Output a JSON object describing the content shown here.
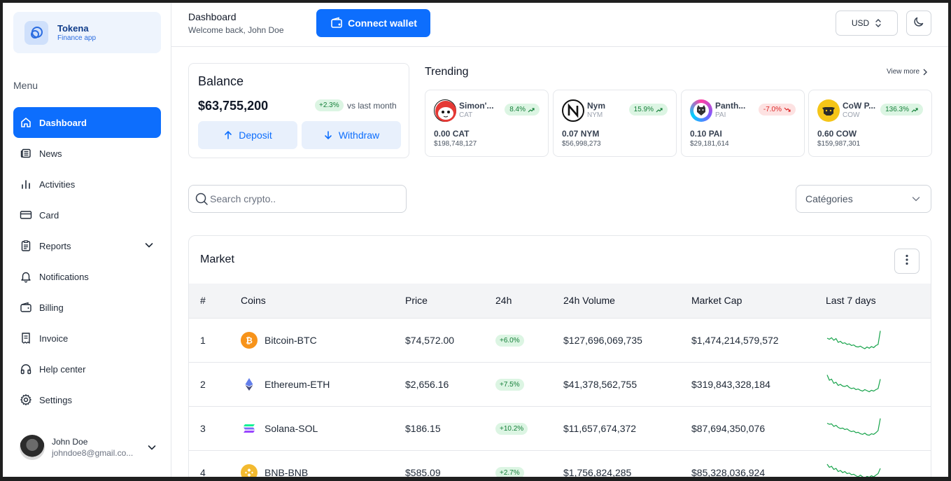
{
  "brand": {
    "name": "Tokena",
    "subtitle": "Finance app"
  },
  "menu": {
    "title": "Menu",
    "items": [
      {
        "label": "Dashboard",
        "icon": "home-icon",
        "active": true
      },
      {
        "label": "News",
        "icon": "newspaper-icon"
      },
      {
        "label": "Activities",
        "icon": "bar-chart-icon"
      },
      {
        "label": "Card",
        "icon": "credit-card-icon"
      },
      {
        "label": "Reports",
        "icon": "clipboard-icon",
        "expandable": true
      },
      {
        "label": "Notifications",
        "icon": "bell-icon"
      },
      {
        "label": "Billing",
        "icon": "wallet-icon"
      },
      {
        "label": "Invoice",
        "icon": "receipt-icon"
      },
      {
        "label": "Help center",
        "icon": "headphones-icon"
      },
      {
        "label": "Settings",
        "icon": "gear-icon"
      }
    ]
  },
  "user": {
    "name": "John Doe",
    "email": "johndoe8@gmail.co..."
  },
  "header": {
    "title": "Dashboard",
    "subtitle": "Welcome back, John Doe",
    "connect_label": "Connect wallet",
    "currency": "USD"
  },
  "balance": {
    "title": "Balance",
    "amount": "$63,755,200",
    "change": "+2.3%",
    "compare": "vs last month",
    "deposit_label": "Deposit",
    "withdraw_label": "Withdraw"
  },
  "trending": {
    "title": "Trending",
    "view_more": "View more",
    "items": [
      {
        "name": "Simon'...",
        "symbol": "CAT",
        "change": "8.4%",
        "direction": "up",
        "holding": "0.00 CAT",
        "value": "$198,748,127"
      },
      {
        "name": "Nym",
        "symbol": "NYM",
        "change": "15.9%",
        "direction": "up",
        "holding": "0.07 NYM",
        "value": "$56,998,273"
      },
      {
        "name": "Panth...",
        "symbol": "PAI",
        "change": "-7.0%",
        "direction": "down",
        "holding": "0.10 PAI",
        "value": "$29,181,614"
      },
      {
        "name": "CoW P...",
        "symbol": "COW",
        "change": "136.3%",
        "direction": "up",
        "holding": "0.60 COW",
        "value": "$159,987,301"
      }
    ]
  },
  "search": {
    "placeholder": "Search crypto.."
  },
  "categories": {
    "label": "Catégories"
  },
  "market": {
    "title": "Market",
    "columns": [
      "#",
      "Coins",
      "Price",
      "24h",
      "24h Volume",
      "Market Cap",
      "Last 7 days"
    ],
    "rows": [
      {
        "rank": "1",
        "coin": "Bitcoin-BTC",
        "price": "$74,572.00",
        "change": "+6.0%",
        "volume": "$127,696,069,735",
        "cap": "$1,474,214,579,572",
        "color": "#f7931a",
        "trend": [
          0.6,
          0.55,
          0.62,
          0.5,
          0.58,
          0.4,
          0.45,
          0.35,
          0.38,
          0.3,
          0.33,
          0.25,
          0.28,
          0.2,
          0.18,
          0.22,
          0.15,
          0.1,
          0.18,
          0.12,
          0.2,
          0.15,
          0.25,
          0.3,
          0.95
        ]
      },
      {
        "rank": "2",
        "coin": "Ethereum-ETH",
        "price": "$2,656.16",
        "change": "+7.5%",
        "volume": "$41,378,562,755",
        "cap": "$319,843,328,184",
        "color": "#627eea",
        "trend": [
          0.95,
          0.7,
          0.75,
          0.55,
          0.6,
          0.45,
          0.5,
          0.42,
          0.4,
          0.45,
          0.35,
          0.3,
          0.33,
          0.25,
          0.28,
          0.22,
          0.18,
          0.25,
          0.2,
          0.15,
          0.22,
          0.18,
          0.25,
          0.3,
          0.75
        ]
      },
      {
        "rank": "3",
        "coin": "Solana-SOL",
        "price": "$186.15",
        "change": "+10.2%",
        "volume": "$11,657,674,372",
        "cap": "$87,694,350,076",
        "color": "#9945ff",
        "trend": [
          0.75,
          0.7,
          0.72,
          0.6,
          0.65,
          0.55,
          0.5,
          0.52,
          0.45,
          0.48,
          0.4,
          0.35,
          0.38,
          0.3,
          0.32,
          0.25,
          0.22,
          0.28,
          0.2,
          0.18,
          0.25,
          0.22,
          0.3,
          0.4,
          0.98
        ]
      },
      {
        "rank": "4",
        "coin": "BNB-BNB",
        "price": "$585.09",
        "change": "+2.7%",
        "volume": "$1,756,824,285",
        "cap": "$85,328,036,924",
        "color": "#f3ba2f",
        "trend": [
          0.9,
          0.75,
          0.8,
          0.65,
          0.7,
          0.55,
          0.6,
          0.5,
          0.55,
          0.45,
          0.48,
          0.4,
          0.42,
          0.35,
          0.3,
          0.38,
          0.3,
          0.25,
          0.32,
          0.28,
          0.35,
          0.3,
          0.38,
          0.45,
          0.7
        ]
      }
    ]
  }
}
